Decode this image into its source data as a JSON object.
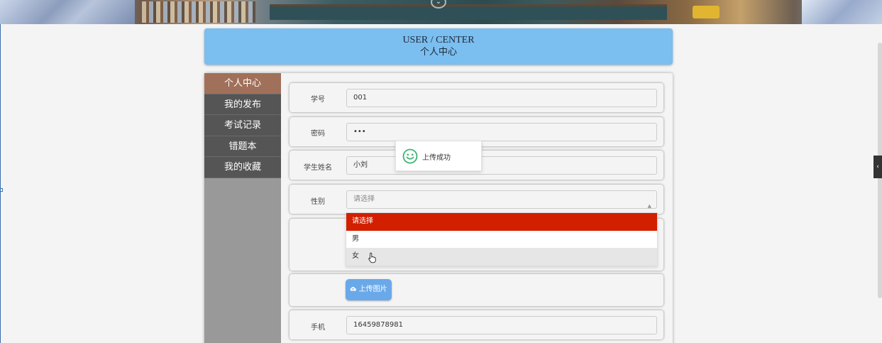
{
  "header": {
    "title_en": "USER / CENTER",
    "title_zh": "个人中心"
  },
  "sidebar": {
    "items": [
      {
        "label": "个人中心",
        "active": true
      },
      {
        "label": "我的发布"
      },
      {
        "label": "考试记录"
      },
      {
        "label": "错题本"
      },
      {
        "label": "我的收藏"
      }
    ]
  },
  "form": {
    "student_id": {
      "label": "学号",
      "value": "001"
    },
    "password": {
      "label": "密码",
      "value": "•••"
    },
    "student_name": {
      "label": "学生姓名",
      "value": "小刘"
    },
    "gender": {
      "label": "性别",
      "placeholder": "请选择",
      "options": [
        "请选择",
        "男",
        "女"
      ],
      "selected_index": 0,
      "hover_index": 2
    },
    "upload_button": {
      "label": "上传图片"
    },
    "phone": {
      "label": "手机",
      "value": "16459878981"
    }
  },
  "toast": {
    "message": "上传成功"
  },
  "colors": {
    "title_bg": "#7bbef0",
    "sidebar_active": "#a0705a",
    "sidebar_item": "#555555",
    "option_selected": "#d11f00",
    "upload_button": "#6aa9e9"
  }
}
